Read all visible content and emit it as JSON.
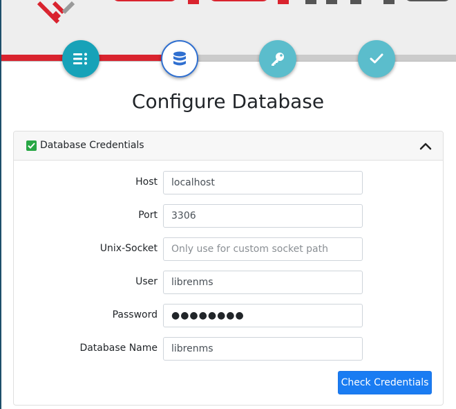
{
  "colors": {
    "brand_red": "#d9232e",
    "step_active": "#17a2b8",
    "step_inactive": "#5bbdcc",
    "primary_button": "#1a7cf2",
    "success_check": "#28a745"
  },
  "header": {
    "logo_icon": "librenms-logo-mark",
    "logo_text_icon": "librenms-wordmark"
  },
  "stepper": [
    {
      "icon": "list-icon",
      "state": "complete"
    },
    {
      "icon": "database-icon",
      "state": "current"
    },
    {
      "icon": "key-icon",
      "state": "pending"
    },
    {
      "icon": "check-icon",
      "state": "pending"
    }
  ],
  "page": {
    "title": "Configure Database"
  },
  "card": {
    "title": "Database Credentials",
    "status_icon": "checkbox-checked-icon",
    "collapse_icon": "chevron-up-icon"
  },
  "form": {
    "host": {
      "label": "Host",
      "value": "localhost",
      "placeholder": ""
    },
    "port": {
      "label": "Port",
      "value": "3306",
      "placeholder": ""
    },
    "socket": {
      "label": "Unix-Socket",
      "value": "",
      "placeholder": "Only use for custom socket path"
    },
    "user": {
      "label": "User",
      "value": "librenms",
      "placeholder": ""
    },
    "password": {
      "label": "Password",
      "value": "●●●●●●●●",
      "placeholder": ""
    },
    "db_name": {
      "label": "Database Name",
      "value": "librenms",
      "placeholder": ""
    }
  },
  "actions": {
    "check_label": "Check Credentials"
  }
}
